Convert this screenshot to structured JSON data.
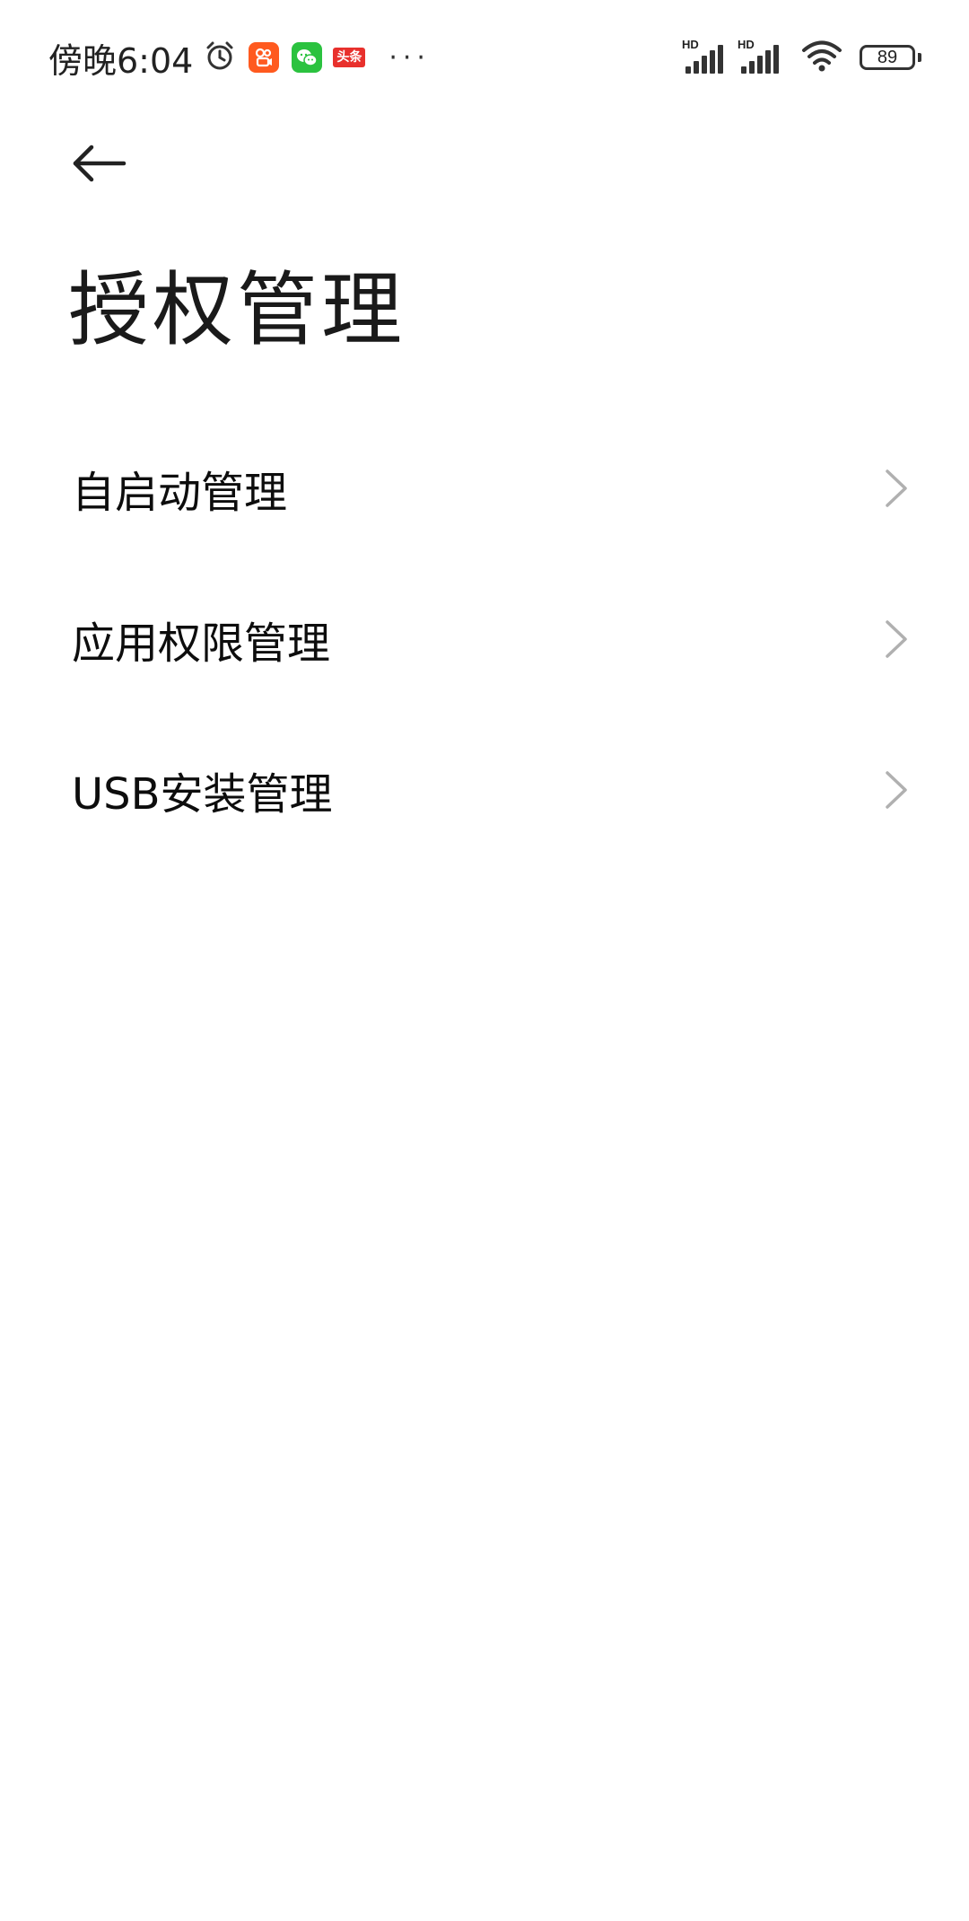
{
  "status_bar": {
    "time": "傍晚6:04",
    "notification_icons": [
      "alarm-icon",
      "kuaishou-app-icon",
      "wechat-app-icon",
      "toutiao-app-icon"
    ],
    "toutiao_label": "头条",
    "more_indicator": "···",
    "signal_1_label": "HD",
    "signal_2_label": "HD",
    "battery_level": "89"
  },
  "header": {
    "back_icon": "arrow-left-icon",
    "title": "授权管理"
  },
  "settings": {
    "items": [
      {
        "label": "自启动管理",
        "icon": "chevron-right-icon"
      },
      {
        "label": "应用权限管理",
        "icon": "chevron-right-icon"
      },
      {
        "label": "USB安装管理",
        "icon": "chevron-right-icon"
      }
    ]
  },
  "colors": {
    "background": "#ffffff",
    "text_primary": "#0d0d0d",
    "chevron": "#b0b0b0",
    "kuaishou": "#ff5a1f",
    "wechat": "#2bc23f",
    "toutiao": "#e8302c"
  }
}
